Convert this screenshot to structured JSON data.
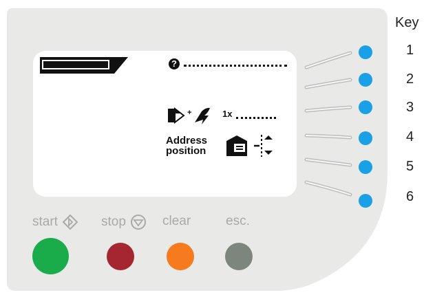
{
  "key": {
    "title": "Key",
    "numbers": [
      "1",
      "2",
      "3",
      "4",
      "5",
      "6"
    ]
  },
  "screen": {
    "copy_count": "1x",
    "address_label_line1": "Address",
    "address_label_line2": "position"
  },
  "buttons": {
    "start": "start",
    "stop": "stop",
    "clear": "clear",
    "esc": "esc."
  },
  "colors": {
    "panel": "#e9e9e7",
    "key_dot": "#1aa0e6",
    "start": "#1aab4b",
    "stop": "#a52630",
    "clear": "#f57b1e",
    "esc": "#7c867d"
  }
}
